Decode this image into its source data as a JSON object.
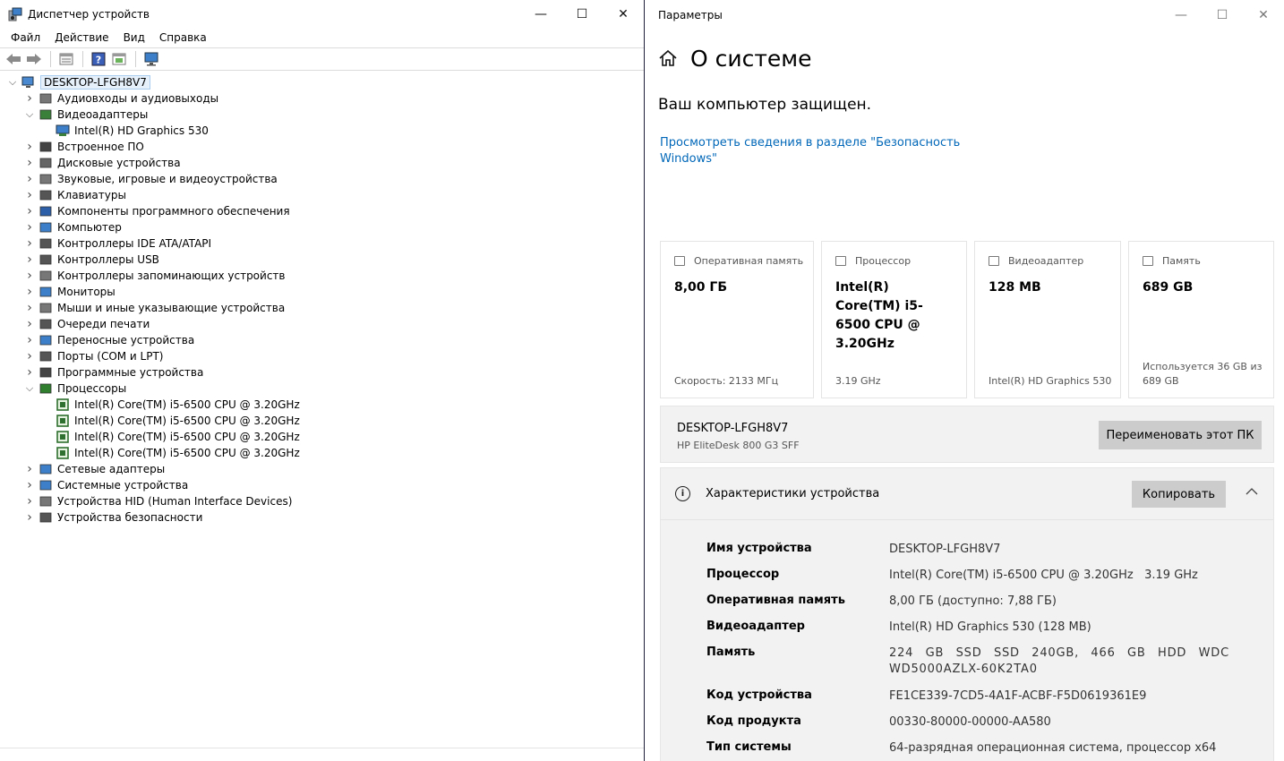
{
  "device_manager": {
    "title": "Диспетчер устройств",
    "menu": [
      "Файл",
      "Действие",
      "Вид",
      "Справка"
    ],
    "controls": {
      "minimize": "—",
      "maximize": "☐",
      "close": "✕"
    },
    "tree": {
      "root": "DESKTOP-LFGH8V7",
      "categories": [
        {
          "label": "Аудиовходы и аудиовыходы",
          "expanded": false
        },
        {
          "label": "Видеоадаптеры",
          "expanded": true,
          "children": [
            "Intel(R) HD Graphics 530"
          ]
        },
        {
          "label": "Встроенное ПО",
          "expanded": false
        },
        {
          "label": "Дисковые устройства",
          "expanded": false
        },
        {
          "label": "Звуковые, игровые и видеоустройства",
          "expanded": false
        },
        {
          "label": "Клавиатуры",
          "expanded": false
        },
        {
          "label": "Компоненты программного обеспечения",
          "expanded": false
        },
        {
          "label": "Компьютер",
          "expanded": false
        },
        {
          "label": "Контроллеры IDE ATA/ATAPI",
          "expanded": false
        },
        {
          "label": "Контроллеры USB",
          "expanded": false
        },
        {
          "label": "Контроллеры запоминающих устройств",
          "expanded": false
        },
        {
          "label": "Мониторы",
          "expanded": false
        },
        {
          "label": "Мыши и иные указывающие устройства",
          "expanded": false
        },
        {
          "label": "Очереди печати",
          "expanded": false
        },
        {
          "label": "Переносные устройства",
          "expanded": false
        },
        {
          "label": "Порты (COM и LPT)",
          "expanded": false
        },
        {
          "label": "Программные устройства",
          "expanded": false
        },
        {
          "label": "Процессоры",
          "expanded": true,
          "children": [
            "Intel(R) Core(TM) i5-6500 CPU @ 3.20GHz",
            "Intel(R) Core(TM) i5-6500 CPU @ 3.20GHz",
            "Intel(R) Core(TM) i5-6500 CPU @ 3.20GHz",
            "Intel(R) Core(TM) i5-6500 CPU @ 3.20GHz"
          ]
        },
        {
          "label": "Сетевые адаптеры",
          "expanded": false
        },
        {
          "label": "Системные устройства",
          "expanded": false
        },
        {
          "label": "Устройства HID (Human Interface Devices)",
          "expanded": false
        },
        {
          "label": "Устройства безопасности",
          "expanded": false
        }
      ]
    }
  },
  "settings": {
    "window_title": "Параметры",
    "controls": {
      "minimize": "—",
      "maximize": "☐",
      "close": "✕"
    },
    "page_title": "О системе",
    "protected_text": "Ваш компьютер защищен.",
    "security_link": "Просмотреть сведения в разделе \"Безопасность Windows\"",
    "cards": {
      "ram": {
        "title": "Оперативная память",
        "value": "8,00 ГБ",
        "sub": "Скорость: 2133 МГц"
      },
      "cpu": {
        "title": "Процессор",
        "value": "Intel(R) Core(TM) i5-6500 CPU @ 3.20GHz",
        "sub": "3.19 GHz"
      },
      "gpu": {
        "title": "Видеоадаптер",
        "value": "128 MB",
        "sub": "Intel(R) HD Graphics 530"
      },
      "storage": {
        "title": "Память",
        "value": "689 GB",
        "sub": "Используется 36 GB из 689 GB"
      }
    },
    "pc": {
      "name": "DESKTOP-LFGH8V7",
      "model": "HP EliteDesk 800 G3 SFF",
      "rename_button": "Переименовать этот ПК"
    },
    "specs": {
      "title": "Характеристики устройства",
      "copy_button": "Копировать",
      "rows": {
        "device_name": {
          "label": "Имя устройства",
          "value": "DESKTOP-LFGH8V7"
        },
        "processor": {
          "label": "Процессор",
          "value": "Intel(R) Core(TM) i5-6500 CPU @ 3.20GHz   3.19 GHz"
        },
        "ram": {
          "label": "Оперативная память",
          "value": "8,00 ГБ (доступно: 7,88 ГБ)"
        },
        "gpu": {
          "label": "Видеоадаптер",
          "value": "Intel(R) HD Graphics 530 (128 MB)"
        },
        "storage": {
          "label": "Память",
          "value": "224 GB SSD SSD 240GB, 466 GB HDD WDC WD5000AZLX-60K2TA0"
        },
        "device_id": {
          "label": "Код устройства",
          "value": "FE1CE339-7CD5-4A1F-ACBF-F5D0619361E9"
        },
        "product_id": {
          "label": "Код продукта",
          "value": "00330-80000-00000-AA580"
        },
        "system_type": {
          "label": "Тип системы",
          "value": "64-разрядная операционная система, процессор x64"
        }
      }
    }
  }
}
